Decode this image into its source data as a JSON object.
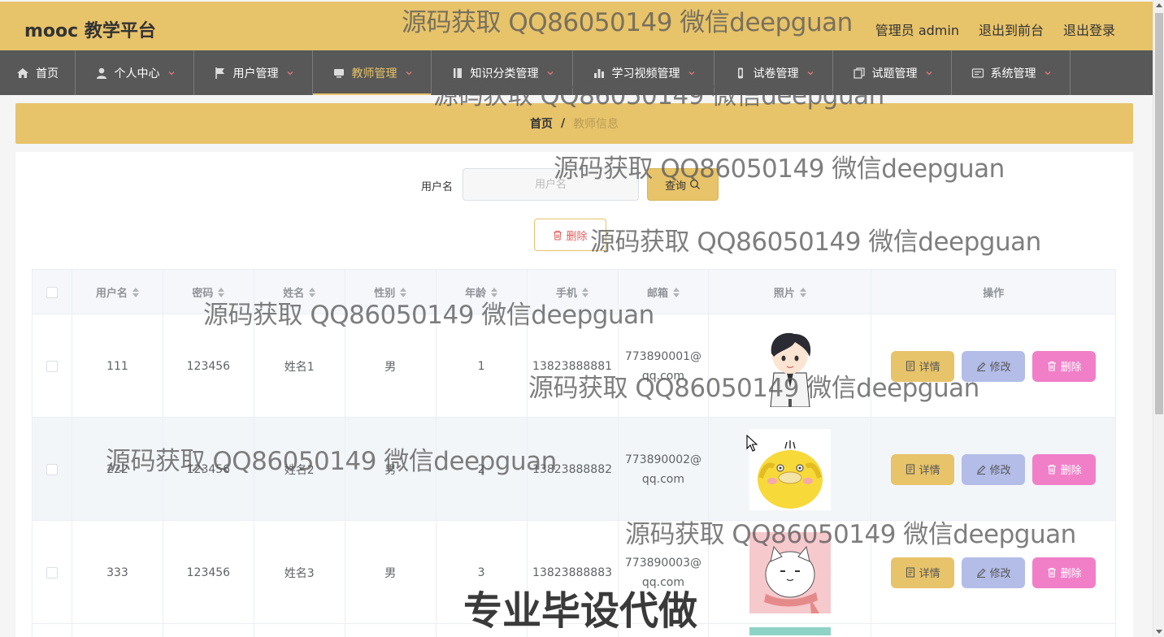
{
  "brand": "mooc 教学平台",
  "header_links": [
    "管理员 admin",
    "退出到前台",
    "退出登录"
  ],
  "nav": [
    {
      "label": "首页",
      "icon": "home-icon",
      "caret": false,
      "active": false
    },
    {
      "label": "个人中心",
      "icon": "user-icon",
      "caret": true,
      "active": false
    },
    {
      "label": "用户管理",
      "icon": "flag-icon",
      "caret": true,
      "active": false
    },
    {
      "label": "教师管理",
      "icon": "monitor-icon",
      "caret": true,
      "active": true
    },
    {
      "label": "知识分类管理",
      "icon": "bookmark-icon",
      "caret": true,
      "active": false
    },
    {
      "label": "学习视频管理",
      "icon": "bar-chart-icon",
      "caret": true,
      "active": false
    },
    {
      "label": "试卷管理",
      "icon": "phone-icon",
      "caret": true,
      "active": false
    },
    {
      "label": "试题管理",
      "icon": "copy-icon",
      "caret": true,
      "active": false
    },
    {
      "label": "系统管理",
      "icon": "message-icon",
      "caret": true,
      "active": false
    }
  ],
  "breadcrumb": {
    "home": "首页",
    "sep": "/",
    "current": "教师信息"
  },
  "search": {
    "label": "用户名",
    "placeholder": "用户名",
    "value": "",
    "button": "查询"
  },
  "bulk_delete": "删除",
  "table": {
    "headers": [
      "用户名",
      "密码",
      "姓名",
      "性别",
      "年龄",
      "手机",
      "邮箱",
      "照片",
      "操作"
    ],
    "rows": [
      {
        "username": "111",
        "password": "123456",
        "name": "姓名1",
        "gender": "男",
        "age": "1",
        "phone": "13823888881",
        "email": "773890001@qq.com",
        "photo": "boy-avatar"
      },
      {
        "username": "222",
        "password": "123456",
        "name": "姓名2",
        "gender": "男",
        "age": "2",
        "phone": "13823888882",
        "email": "773890002@qq.com",
        "photo": "duck-avatar"
      },
      {
        "username": "333",
        "password": "123456",
        "name": "姓名3",
        "gender": "男",
        "age": "3",
        "phone": "13823888883",
        "email": "773890003@qq.com",
        "photo": "cat-avatar"
      }
    ],
    "actions": {
      "detail": "详情",
      "edit": "修改",
      "delete": "删除"
    }
  },
  "watermark": "源码获取 QQ86050149 微信deepguan",
  "bottom_banner": "专业毕设代做",
  "colors": {
    "primary": "#e7c36a",
    "nav_bg": "#585858",
    "edit": "#b3bde8",
    "delete": "#f07fc8"
  }
}
